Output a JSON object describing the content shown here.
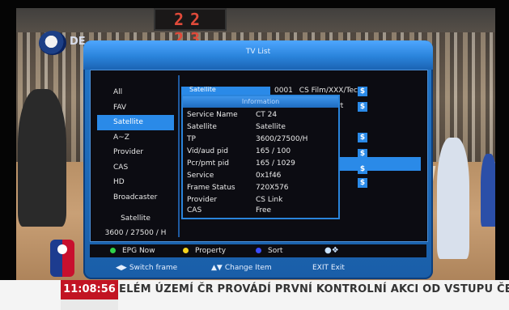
{
  "background": {
    "scoreboard": "22 23",
    "channel_logo_text": "DE"
  },
  "window": {
    "title": "TV List"
  },
  "categories": [
    {
      "label": "All"
    },
    {
      "label": "FAV"
    },
    {
      "label": "Satellite"
    },
    {
      "label": "A~Z"
    },
    {
      "label": "Provider"
    },
    {
      "label": "CAS"
    },
    {
      "label": "HD"
    },
    {
      "label": "Broadcaster"
    }
  ],
  "selected_category": "Satellite",
  "current": {
    "satellite": "Satellite",
    "tp": "3600 / 27500 / H"
  },
  "satellite_tab": "Satellite",
  "channels": [
    {
      "number": "0001",
      "name": "CS Film/XXX/Tec",
      "icon": "$"
    },
    {
      "name": "rt",
      "icon": "$"
    }
  ],
  "scrambled_icons": [
    "$",
    "$",
    "$",
    "$"
  ],
  "info": {
    "title": "Information",
    "rows": [
      {
        "key": "Service Name",
        "value": "CT 24"
      },
      {
        "key": "Satellite",
        "value": "Satellite"
      },
      {
        "key": "TP",
        "value": "3600/27500/H"
      },
      {
        "key": "Vid/aud pid",
        "value": "165 / 100"
      },
      {
        "key": "Pcr/pmt pid",
        "value": "165 / 1029"
      },
      {
        "key": "Service",
        "value": "0x1f46"
      },
      {
        "key": "Frame Status",
        "value": "720X576"
      },
      {
        "key": "Provider",
        "value": "CS Link"
      },
      {
        "key": "CAS",
        "value": "Free"
      }
    ]
  },
  "hints": {
    "green": "EPG Now",
    "yellow": "Property",
    "blue": "Sort",
    "colors": {
      "green": "#2fd14a",
      "yellow": "#f4d21e",
      "blue": "#3b4cff"
    }
  },
  "nav": {
    "switch_frame": "Switch frame",
    "change_item": "Change Item",
    "exit": "EXIT Exit"
  },
  "ticker": {
    "clock": "11:08:56",
    "text": "ELÉM ÚZEMÍ ČR PROVÁDÍ PRVNÍ KONTROLNÍ AKCI OD VSTUPU ČES"
  }
}
